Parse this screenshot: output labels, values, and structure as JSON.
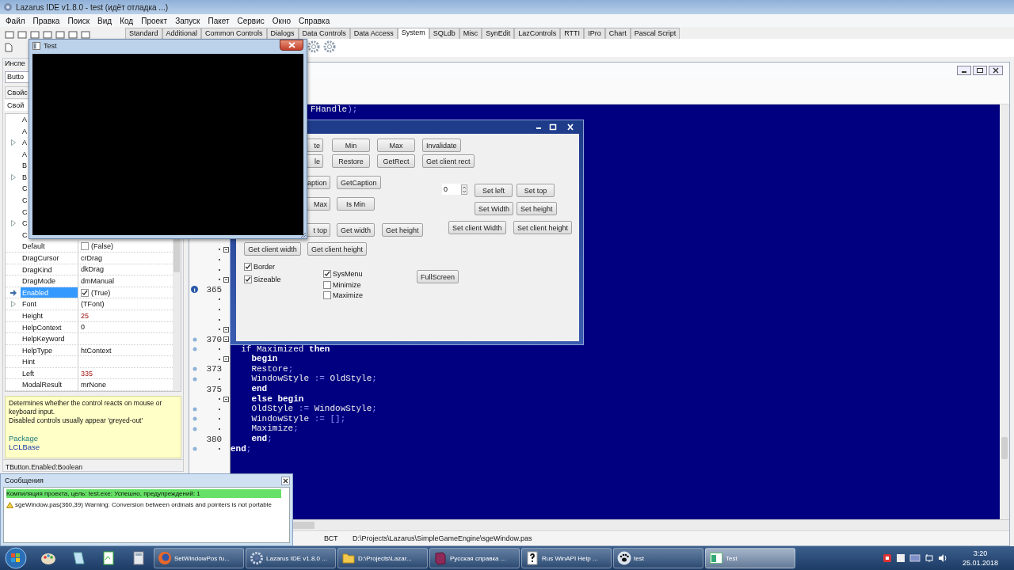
{
  "ide": {
    "title": "Lazarus IDE v1.8.0 - test (идёт отладка ...)",
    "menu": [
      "Файл",
      "Правка",
      "Поиск",
      "Вид",
      "Код",
      "Проект",
      "Запуск",
      "Пакет",
      "Сервис",
      "Окно",
      "Справка"
    ],
    "palette_tabs": [
      {
        "label": "Standard",
        "selected": false
      },
      {
        "label": "Additional",
        "selected": false
      },
      {
        "label": "Common Controls",
        "selected": false
      },
      {
        "label": "Dialogs",
        "selected": false
      },
      {
        "label": "Data Controls",
        "selected": false
      },
      {
        "label": "Data Access",
        "selected": false
      },
      {
        "label": "System",
        "selected": true
      },
      {
        "label": "SQLdb",
        "selected": false
      },
      {
        "label": "Misc",
        "selected": false
      },
      {
        "label": "SynEdit",
        "selected": false
      },
      {
        "label": "LazControls",
        "selected": false
      },
      {
        "label": "RTTI",
        "selected": false
      },
      {
        "label": "IPro",
        "selected": false
      },
      {
        "label": "Chart",
        "selected": false
      },
      {
        "label": "Pascal Script",
        "selected": false
      }
    ]
  },
  "inspector": {
    "header": "Инспе",
    "component": "Butto",
    "section": "Свойс",
    "tab": "Свой",
    "properties": [
      {
        "name": "A",
        "kind": "text",
        "expandable": false,
        "selected": false
      },
      {
        "name": "A",
        "kind": "text",
        "expandable": false,
        "selected": false
      },
      {
        "name": "A",
        "kind": "text",
        "expandable": true,
        "selected": false
      },
      {
        "name": "A",
        "kind": "text",
        "expandable": false,
        "selected": false
      },
      {
        "name": "B",
        "kind": "text",
        "expandable": false,
        "selected": false
      },
      {
        "name": "B",
        "kind": "text",
        "expandable": true,
        "selected": false
      },
      {
        "name": "C",
        "kind": "text",
        "expandable": false,
        "selected": false
      },
      {
        "name": "C",
        "kind": "text",
        "expandable": false,
        "selected": false
      },
      {
        "name": "C",
        "kind": "text",
        "expandable": false,
        "selected": false
      },
      {
        "name": "C",
        "kind": "text",
        "expandable": true,
        "selected": false
      },
      {
        "name": "C",
        "kind": "text",
        "expandable": false,
        "selected": false
      },
      {
        "name": "Default",
        "kind": "check",
        "value": "(False)",
        "checked": false,
        "expandable": false,
        "selected": false,
        "modified": false
      },
      {
        "name": "DragCursor",
        "kind": "text",
        "value": "crDrag",
        "expandable": false,
        "selected": false,
        "modified": false
      },
      {
        "name": "DragKind",
        "kind": "text",
        "value": "dkDrag",
        "expandable": false,
        "selected": false,
        "modified": false
      },
      {
        "name": "DragMode",
        "kind": "text",
        "value": "dmManual",
        "expandable": false,
        "selected": false,
        "modified": false
      },
      {
        "name": "Enabled",
        "kind": "check",
        "value": "(True)",
        "checked": true,
        "expandable": false,
        "selected": true,
        "modified": false
      },
      {
        "name": "Font",
        "kind": "text",
        "value": "(TFont)",
        "expandable": true,
        "selected": false,
        "modified": false
      },
      {
        "name": "Height",
        "kind": "text",
        "value": "25",
        "expandable": false,
        "selected": false,
        "modified": true
      },
      {
        "name": "HelpContext",
        "kind": "text",
        "value": "0",
        "expandable": false,
        "selected": false,
        "modified": false
      },
      {
        "name": "HelpKeyword",
        "kind": "text",
        "expandable": false,
        "selected": false
      },
      {
        "name": "HelpType",
        "kind": "text",
        "value": "htContext",
        "expandable": false,
        "selected": false,
        "modified": false
      },
      {
        "name": "Hint",
        "kind": "text",
        "expandable": false,
        "selected": false
      },
      {
        "name": "Left",
        "kind": "text",
        "value": "335",
        "expandable": false,
        "selected": false,
        "modified": true
      },
      {
        "name": "ModalResult",
        "kind": "text",
        "value": "mrNone",
        "expandable": false,
        "selected": false,
        "modified": false
      }
    ],
    "description": [
      "Determines whether the control reacts on mouse or keyboard input.",
      "Disabled controls usually appear 'greyed-out'"
    ],
    "package_label": "Package",
    "package": "LCLBase",
    "status": "TButton.Enabled:Boolean"
  },
  "editor": {
    "fragment": [
      {
        "kind": "id",
        "text": "FHandle"
      },
      {
        "kind": "sym",
        "text": ");"
      }
    ],
    "gutter": [
      {
        "kind": "plain",
        "fold": true
      },
      {
        "kind": "plain",
        "fold": false
      },
      {
        "kind": "plain",
        "fold": false
      },
      {
        "kind": "plain",
        "fold": true
      },
      {
        "number": "365",
        "kind": "info",
        "fold": false
      },
      {
        "kind": "plain",
        "fold": false
      },
      {
        "kind": "plain",
        "fold": false
      },
      {
        "kind": "plain",
        "fold": false
      },
      {
        "kind": "plain",
        "fold": true
      },
      {
        "number": "370",
        "kind": "dot",
        "fold": true
      },
      {
        "kind": "dot",
        "fold": false
      },
      {
        "kind": "plain",
        "fold": true
      },
      {
        "number": "373",
        "kind": "dot",
        "fold": false
      },
      {
        "kind": "dot",
        "fold": false
      },
      {
        "number": "375",
        "kind": "plain",
        "fold": false
      },
      {
        "kind": "plain",
        "fold": true
      },
      {
        "kind": "dot",
        "fold": false
      },
      {
        "kind": "dot",
        "fold": false
      },
      {
        "kind": "dot",
        "fold": false
      },
      {
        "number": "380",
        "kind": "plain",
        "fold": false
      },
      {
        "kind": "dot",
        "fold": false
      }
    ],
    "lines": [
      [
        {
          "kind": "id",
          "text": "  if Maximized "
        },
        {
          "kind": "kw",
          "text": "then"
        }
      ],
      [
        {
          "kind": "kw",
          "text": "    begin"
        }
      ],
      [
        {
          "kind": "id",
          "text": "    Restore"
        },
        {
          "kind": "sym",
          "text": ";"
        }
      ],
      [
        {
          "kind": "id",
          "text": "    WindowStyle "
        },
        {
          "kind": "sym",
          "text": ":="
        },
        {
          "kind": "id",
          "text": " OldStyle"
        },
        {
          "kind": "sym",
          "text": ";"
        }
      ],
      [
        {
          "kind": "kw",
          "text": "    end"
        }
      ],
      [
        {
          "kind": "kw",
          "text": "    else begin"
        }
      ],
      [
        {
          "kind": "id",
          "text": "    OldStyle "
        },
        {
          "kind": "sym",
          "text": ":="
        },
        {
          "kind": "id",
          "text": " WindowStyle"
        },
        {
          "kind": "sym",
          "text": ";"
        }
      ],
      [
        {
          "kind": "id",
          "text": "    WindowStyle "
        },
        {
          "kind": "sym",
          "text": ":= [];"
        }
      ],
      [
        {
          "kind": "id",
          "text": "    Maximize"
        },
        {
          "kind": "sym",
          "text": ";"
        }
      ],
      [
        {
          "kind": "kw",
          "text": "    end"
        },
        {
          "kind": "sym",
          "text": ";"
        }
      ],
      [
        {
          "kind": "kw",
          "text": "end"
        },
        {
          "kind": "sym",
          "text": ";"
        }
      ]
    ],
    "status": {
      "mode": "ВСТ",
      "path": "D:\\Projects\\Lazarus\\SimpleGameEngine\\sgeWindow.pas"
    }
  },
  "messages": {
    "title": "Сообщения",
    "items": [
      {
        "kind": "success",
        "text": "Компиляция проекта, цель: test.exe: Успешно, предупреждений: 1"
      },
      {
        "kind": "warning",
        "text": "sgeWindow.pas(360,39) Warning: Conversion between ordinals and pointers is not portable"
      }
    ]
  },
  "test_window": {
    "title": "Test"
  },
  "dialog": {
    "buttons": [
      "te",
      "Min",
      "Max",
      "Invalidate",
      "le",
      "Restore",
      "GetRect",
      "Get client rect",
      "aption",
      "GetCaption",
      "Max",
      "Is Min",
      "t top",
      "Get width",
      "Get height",
      "Get client width",
      "Get client height",
      "Set left",
      "Set top",
      "Set Width",
      "Set height",
      "Set client Width",
      "Set client height",
      "FullScreen"
    ],
    "spin": {
      "value": "0"
    },
    "checkboxes": [
      {
        "label": "Border",
        "checked": true
      },
      {
        "label": "Sizeable",
        "checked": true
      },
      {
        "label": "SysMenu",
        "checked": true
      },
      {
        "label": "Minimize",
        "checked": false
      },
      {
        "label": "Maximize",
        "checked": false
      }
    ]
  },
  "taskbar": {
    "tasks": [
      {
        "kind": "browser",
        "label": "SetWindowPos fu...",
        "selected": false
      },
      {
        "kind": "gear",
        "label": "Lazarus IDE v1.8.0 ...",
        "selected": false
      },
      {
        "kind": "folder",
        "label": "D:\\Projects\\Lazar...",
        "selected": false
      },
      {
        "kind": "book",
        "label": "Русская справка ...",
        "selected": false
      },
      {
        "kind": "help",
        "label": "Rus WinAPI Help ...",
        "selected": false
      },
      {
        "kind": "paw",
        "label": "test",
        "selected": false
      },
      {
        "kind": "form",
        "label": "Test",
        "selected": true
      }
    ],
    "time": "3:20",
    "date": "25.01.2018"
  }
}
